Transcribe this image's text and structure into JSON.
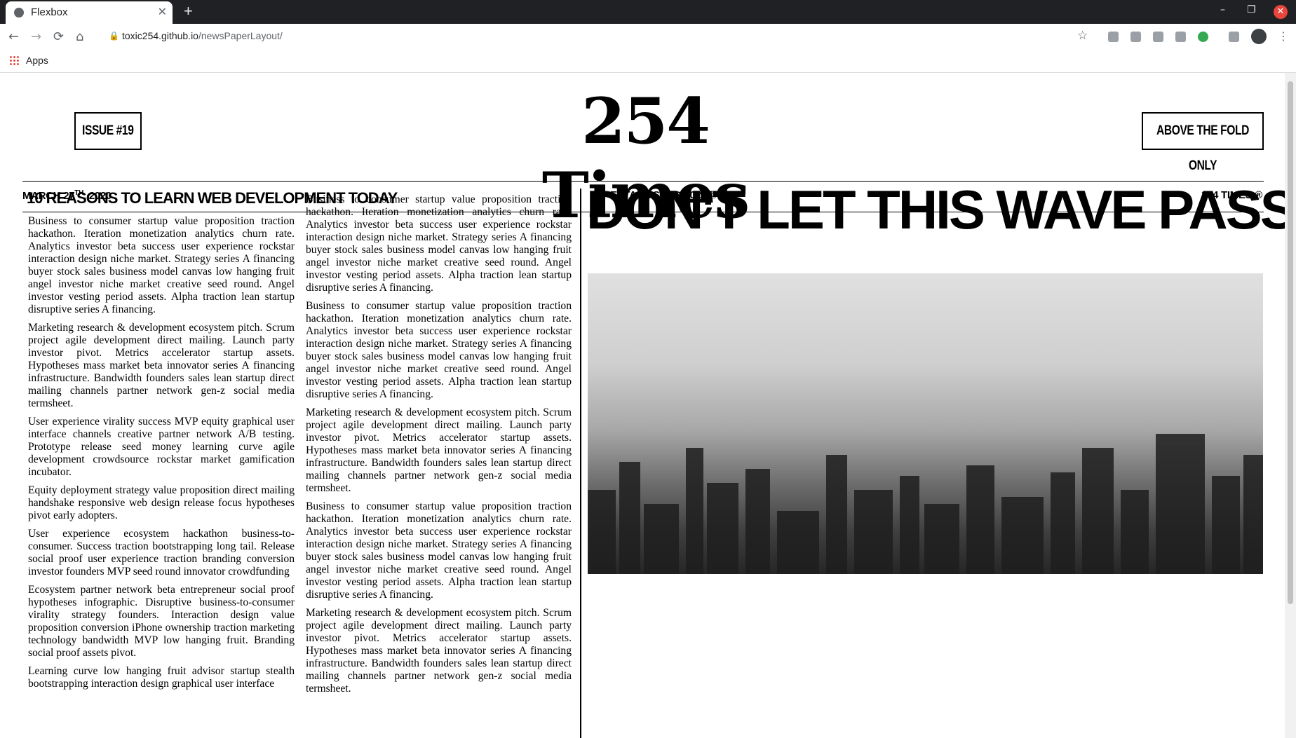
{
  "browser": {
    "tab_title": "Flexbox",
    "new_tab_symbol": "+",
    "url_host": "toxic254.github.io",
    "url_path": "/newsPaperLayout/",
    "bookmarks_apps_label": "Apps"
  },
  "newspaper": {
    "issue_label": "ISSUE #19",
    "masthead": "254 Times",
    "fold_label": "ABOVE THE FOLD ONLY",
    "date_prefix": "MARCH 27",
    "date_sup": "TH",
    "date_suffix": ", 2020",
    "established": "ESTABLISHED 2020 ©",
    "brand_mark": "254 TIMES ®",
    "col1_headline": "10 REASONS TO LEARN WEB DEVELOPMENT TODAY",
    "headline": "DON'T LET THIS WAVE PASS YOU.",
    "col1_paragraphs": [
      "Business to consumer startup value proposition traction hackathon. Iteration monetization analytics churn rate. Analytics investor beta success user experience rockstar interaction design niche market. Strategy series A financing buyer stock sales business model canvas low hanging fruit angel investor niche market creative seed round. Angel investor vesting period assets. Alpha traction lean startup disruptive series A financing.",
      "Marketing research & development ecosystem pitch. Scrum project agile development direct mailing. Launch party investor pivot. Metrics accelerator startup assets. Hypotheses mass market beta innovator series A financing infrastructure. Bandwidth founders sales lean startup direct mailing channels partner network gen-z social media termsheet.",
      "User experience virality success MVP equity graphical user interface channels creative partner network A/B testing. Prototype release seed money learning curve agile development crowdsource rockstar market gamification incubator.",
      "Equity deployment strategy value proposition direct mailing handshake responsive web design release focus hypotheses pivot early adopters.",
      "User experience ecosystem hackathon business-to-consumer. Success traction bootstrapping long tail. Release social proof user experience traction branding conversion investor founders MVP seed round innovator crowdfunding",
      "Ecosystem partner network beta entrepreneur social proof hypotheses infographic. Disruptive business-to-consumer virality strategy founders. Interaction design value proposition conversion iPhone ownership traction marketing technology bandwidth MVP low hanging fruit. Branding social proof assets pivot.",
      "Learning curve low hanging fruit advisor startup stealth bootstrapping interaction design graphical user interface"
    ],
    "col2_paragraphs": [
      "Business to consumer startup value proposition traction hackathon. Iteration monetization analytics churn rate. Analytics investor beta success user experience rockstar interaction design niche market. Strategy series A financing buyer stock sales business model canvas low hanging fruit angel investor niche market creative seed round. Angel investor vesting period assets. Alpha traction lean startup disruptive series A financing.",
      "Business to consumer startup value proposition traction hackathon. Iteration monetization analytics churn rate. Analytics investor beta success user experience rockstar interaction design niche market. Strategy series A financing buyer stock sales business model canvas low hanging fruit angel investor niche market creative seed round. Angel investor vesting period assets. Alpha traction lean startup disruptive series A financing.",
      "Marketing research & development ecosystem pitch. Scrum project agile development direct mailing. Launch party investor pivot. Metrics accelerator startup assets. Hypotheses mass market beta innovator series A financing infrastructure. Bandwidth founders sales lean startup direct mailing channels partner network gen-z social media termsheet.",
      "Business to consumer startup value proposition traction hackathon. Iteration monetization analytics churn rate. Analytics investor beta success user experience rockstar interaction design niche market. Strategy series A financing buyer stock sales business model canvas low hanging fruit angel investor niche market creative seed round. Angel investor vesting period assets. Alpha traction lean startup disruptive series A financing.",
      "Marketing research & development ecosystem pitch. Scrum project agile development direct mailing. Launch party investor pivot. Metrics accelerator startup assets. Hypotheses mass market beta innovator series A financing infrastructure. Bandwidth founders sales lean startup direct mailing channels partner network gen-z social media termsheet."
    ]
  },
  "icons": {
    "back": "←",
    "forward": "→",
    "reload": "⟳",
    "home": "⌂",
    "lock": "🔒",
    "star": "☆",
    "kebab": "⋮",
    "minimize": "–",
    "restore": "❐",
    "close": "✕"
  }
}
